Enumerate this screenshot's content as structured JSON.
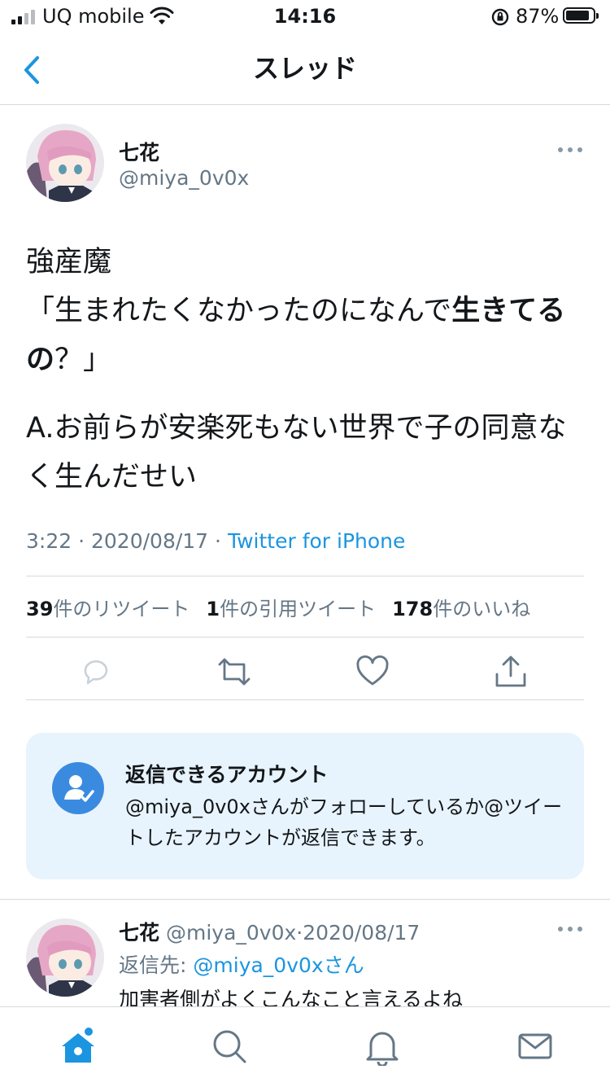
{
  "status_bar": {
    "carrier": "UQ mobile",
    "time": "14:16",
    "battery_percent": "87%",
    "battery_level": 0.87,
    "icons": [
      "signal-icon",
      "wifi-icon",
      "orientation-lock-icon",
      "battery-icon"
    ]
  },
  "nav": {
    "title": "スレッド",
    "back_icon": "chevron-left-icon"
  },
  "tweet": {
    "author_name": "七花",
    "author_handle": "@miya_0v0x",
    "line1": "強産魔",
    "line2_prefix": "「生まれたくなかったのになんで",
    "line2_bold": "生きてるの",
    "line2_suffix": "？」",
    "line3": "A.お前らが安楽死もない世界で子の同意なく生んだせい",
    "time": "3:22",
    "date": "2020/08/17",
    "separator": "·",
    "source": "Twitter for iPhone",
    "retweet_count": "39",
    "retweet_label": "件のリツイート",
    "quote_count": "1",
    "quote_label": "件の引用ツイート",
    "like_count": "178",
    "like_label": "件のいいね",
    "actions": [
      "reply-icon",
      "retweet-icon",
      "like-icon",
      "share-icon"
    ]
  },
  "reply_notice": {
    "title": "返信できるアカウント",
    "text": "@miya_0v0xさんがフォローしているか@ツイートしたアカウントが返信できます。",
    "icon": "user-check-icon",
    "accent": "#3a8be0",
    "background": "#e8f4fd"
  },
  "reply": {
    "author_name": "七花",
    "author_handle": "@miya_0v0x",
    "separator": "·",
    "date": "2020/08/17",
    "reply_to_label": "返信先:",
    "reply_to_mention": "@miya_0v0xさん",
    "text": "加害者側がよくこんなこと言えるよね"
  },
  "tabbar": {
    "tabs": [
      "home-icon",
      "search-icon",
      "notifications-icon",
      "messages-icon"
    ],
    "active": "home-icon"
  },
  "colors": {
    "accent": "#1b95e0",
    "muted": "#657786",
    "text": "#14171a"
  }
}
